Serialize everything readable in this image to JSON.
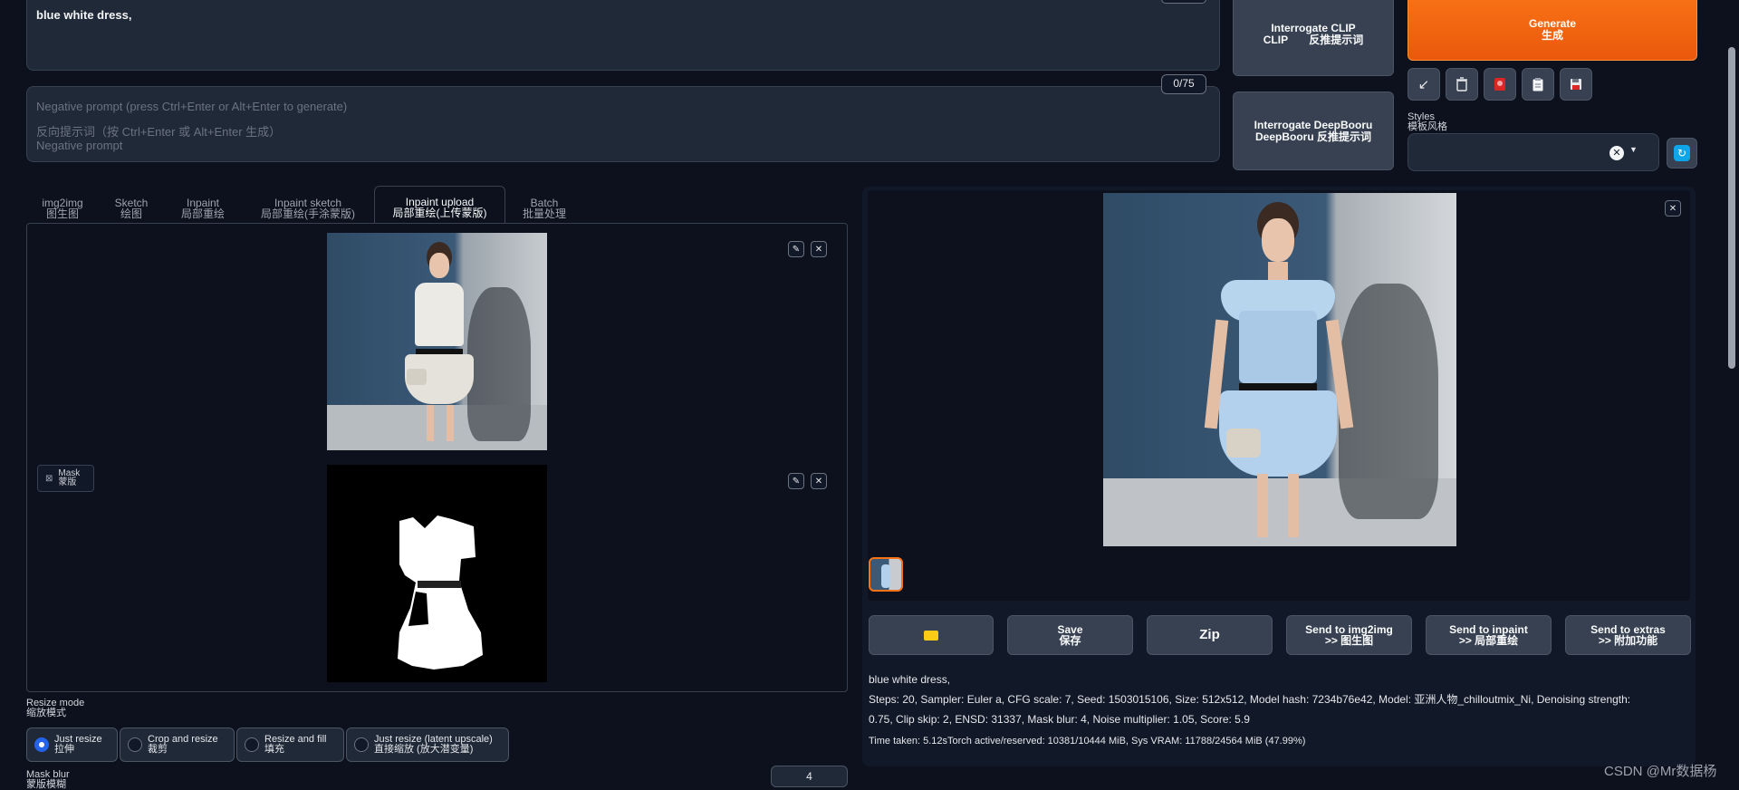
{
  "prompt": {
    "value": "blue white dress,"
  },
  "negative": {
    "counter": "0/75",
    "placeholder_line1": "Negative prompt (press Ctrl+Enter or Alt+Enter to generate)",
    "placeholder_line2": "反向提示词（按 Ctrl+Enter 或 Alt+Enter 生成）",
    "placeholder_line3": "Negative prompt"
  },
  "interrogate": {
    "clip_line1": "Interrogate CLIP",
    "clip_line2": "CLIP       反推提示词",
    "deepbooru_line1": "Interrogate DeepBooru",
    "deepbooru_line2": "DeepBooru 反推提示词"
  },
  "generate": {
    "label": "Generate",
    "label_cn": "生成"
  },
  "toolbar": {
    "icons": [
      "arrow-icon",
      "trash-icon",
      "red-card-icon",
      "clipboard-icon",
      "save-icon"
    ]
  },
  "styles": {
    "label": "Styles",
    "label_cn": "模板风格"
  },
  "tabs": [
    {
      "en": "img2img",
      "cn": "图生图"
    },
    {
      "en": "Sketch",
      "cn": "绘图"
    },
    {
      "en": "Inpaint",
      "cn": "局部重绘"
    },
    {
      "en": "Inpaint sketch",
      "cn": "局部重绘(手涂蒙版)"
    },
    {
      "en": "Inpaint upload",
      "cn": "局部重绘(上传蒙版)"
    },
    {
      "en": "Batch",
      "cn": "批量处理"
    }
  ],
  "mask": {
    "label": "Mask",
    "label_cn": "蒙版"
  },
  "resize": {
    "label": "Resize mode",
    "label_cn": "缩放模式",
    "options": [
      {
        "en": "Just resize",
        "cn": "拉伸"
      },
      {
        "en": "Crop and resize",
        "cn": "裁剪"
      },
      {
        "en": "Resize and fill",
        "cn": "填充"
      },
      {
        "en": "Just resize (latent upscale)",
        "cn": "直接缩放 (放大潜变量)"
      }
    ],
    "selected": "Just resize"
  },
  "mask_blur": {
    "label": "Mask blur",
    "label_cn": "蒙版模糊",
    "value": "4"
  },
  "output_buttons": {
    "zip": "Zip",
    "save": "Save",
    "save_cn": "保存",
    "img2img": "Send to img2img",
    "img2img_cn": ">> 图生图",
    "inpaint": "Send to inpaint",
    "inpaint_cn": ">> 局部重绘",
    "extras": "Send to extras",
    "extras_cn": ">> 附加功能"
  },
  "info": {
    "prompt": "blue white dress,",
    "params_line1": "Steps: 20, Sampler: Euler a, CFG scale: 7, Seed: 1503015106, Size: 512x512, Model hash: 7234b76e42, Model: 亚洲人物_chilloutmix_Ni, Denoising strength:",
    "params_line2": "0.75, Clip skip: 2, ENSD: 31337, Mask blur: 4, Noise multiplier: 1.05, Score: 5.9",
    "time": "Time taken: 5.12sTorch active/reserved: 10381/10444 MiB, Sys VRAM: 11788/24564 MiB (47.99%)"
  },
  "watermark": "CSDN @Mr数据杨",
  "colors": {
    "accent": "#f97316",
    "background": "#0c111d",
    "panel": "#1f2937"
  }
}
